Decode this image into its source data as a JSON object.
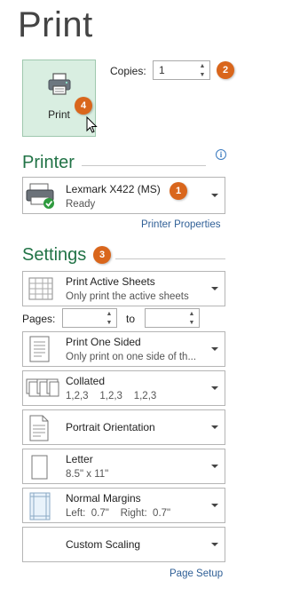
{
  "title": "Print",
  "print_button": {
    "label": "Print"
  },
  "copies": {
    "label": "Copies:",
    "value": "1"
  },
  "badges": [
    "1",
    "2",
    "3",
    "4"
  ],
  "printer": {
    "heading": "Printer",
    "name": "Lexmark X422 (MS)",
    "status": "Ready",
    "properties_link": "Printer Properties"
  },
  "settings": {
    "heading": "Settings",
    "items": [
      {
        "main": "Print Active Sheets",
        "sub": "Only print the active sheets"
      },
      {
        "main": "Print One Sided",
        "sub": "Only print on one side of th..."
      },
      {
        "main": "Collated",
        "sub": "1,2,3    1,2,3    1,2,3"
      },
      {
        "main": "Portrait Orientation"
      },
      {
        "main": "Letter",
        "sub": "8.5\" x 11\""
      },
      {
        "main": "Normal Margins",
        "sub": "Left:  0.7\"    Right:  0.7\""
      },
      {
        "main": "Custom Scaling"
      }
    ],
    "pages_label": "Pages:",
    "to_label": "to",
    "page_setup_link": "Page Setup"
  },
  "colors": {
    "accent_green": "#217346",
    "badge_orange": "#d9661c",
    "link_blue": "#2f5f96"
  }
}
